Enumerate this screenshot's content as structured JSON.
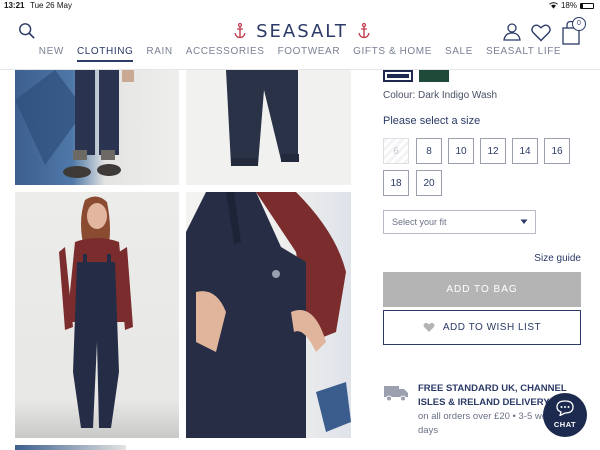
{
  "status_bar": {
    "time": "13:21",
    "date": "Tue 26 May",
    "battery": "18%",
    "battery_level": 0.18
  },
  "header": {
    "brand": "SEASALT",
    "bag_count": "0",
    "nav": [
      {
        "label": "NEW",
        "active": false
      },
      {
        "label": "CLOTHING",
        "active": true
      },
      {
        "label": "RAIN",
        "active": false
      },
      {
        "label": "ACCESSORIES",
        "active": false
      },
      {
        "label": "FOOTWEAR",
        "active": false
      },
      {
        "label": "GIFTS & HOME",
        "active": false
      },
      {
        "label": "SALE",
        "active": false
      },
      {
        "label": "SEASALT LIFE",
        "active": false
      }
    ]
  },
  "product": {
    "colour_label": "Colour: Dark Indigo Wash",
    "swatches": [
      {
        "color": "#1e2a4f",
        "selected": true
      },
      {
        "color": "#1f4a3a",
        "selected": false
      }
    ],
    "size_heading": "Please select a size",
    "sizes": [
      {
        "label": "6",
        "available": false
      },
      {
        "label": "8",
        "available": true
      },
      {
        "label": "10",
        "available": true
      },
      {
        "label": "12",
        "available": true
      },
      {
        "label": "14",
        "available": true
      },
      {
        "label": "16",
        "available": true
      },
      {
        "label": "18",
        "available": true
      },
      {
        "label": "20",
        "available": true
      }
    ],
    "fit_placeholder": "Select your fit",
    "size_guide": "Size guide",
    "add_to_bag": "ADD TO BAG",
    "add_to_wishlist": "ADD TO WISH LIST"
  },
  "delivery": {
    "title": "FREE STANDARD UK, CHANNEL ISLES & IRELAND DELIVERY",
    "subtitle": "on all orders over £20 • 3-5 working days"
  },
  "chat": {
    "label": "CHAT"
  },
  "colors": {
    "brand_navy": "#2b3a67",
    "anchor_red": "#c0394b",
    "button_grey": "#b4b4b4",
    "chat_bg": "#1b2a4e"
  }
}
